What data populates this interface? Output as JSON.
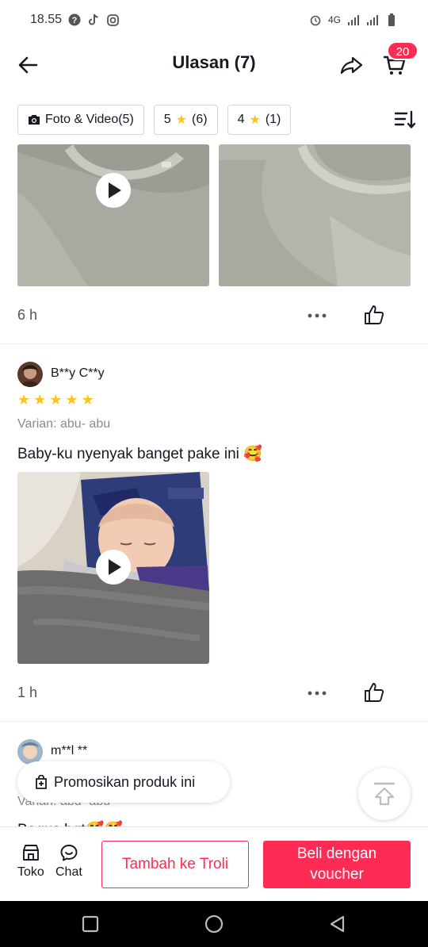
{
  "status_bar": {
    "time": "18.55",
    "network": "4G"
  },
  "header": {
    "title": "Ulasan (7)",
    "cart_count": "20"
  },
  "filters": [
    {
      "label": "Foto & Video(5)"
    },
    {
      "rating": "5",
      "count": "(6)"
    },
    {
      "rating": "4",
      "count": "(1)"
    }
  ],
  "reviews": [
    {
      "time": "6 h"
    },
    {
      "user": "B**y C**y",
      "rating": 5,
      "variant": "Varian: abu- abu",
      "text": "Baby-ku nyenyak banget pake ini 🥰",
      "time": "1 h"
    },
    {
      "user": "m**l **",
      "variant": "Varian: abu- abu",
      "text": "Bagus bgt🥰🥰"
    }
  ],
  "floating": {
    "promo_label": "Promosikan produk ini"
  },
  "bottom_bar": {
    "shop_label": "Toko",
    "chat_label": "Chat",
    "add_to_cart_label": "Tambah ke Troli",
    "buy_label": "Beli dengan voucher"
  },
  "colors": {
    "accent": "#fe2c55",
    "star": "#fcc419"
  }
}
